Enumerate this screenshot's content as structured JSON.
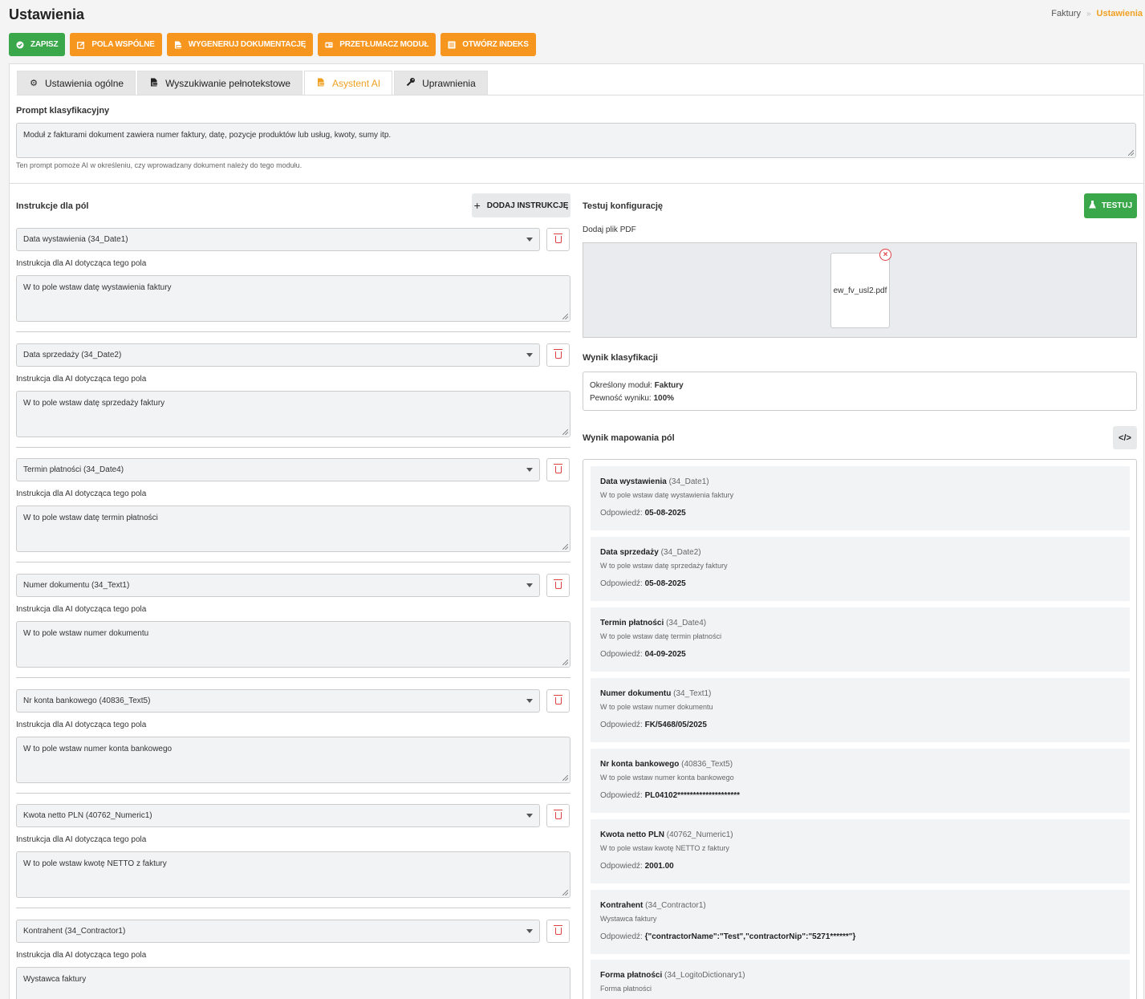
{
  "page_title": "Ustawienia",
  "breadcrumb": {
    "parent": "Faktury",
    "separator": "»",
    "current": "Ustawienia"
  },
  "toolbar": {
    "save": "ZAPISZ",
    "common_fields": "POLA WSPÓLNE",
    "generate_docs": "WYGENERUJ DOKUMENTACJĘ",
    "translate_module": "PRZETŁUMACZ MODUŁ",
    "open_index": "OTWÓRZ INDEKS"
  },
  "tabs": [
    {
      "label": "Ustawienia ogólne",
      "icon": "gear-icon"
    },
    {
      "label": "Wyszukiwanie pełnotekstowe",
      "icon": "pdf-file-icon"
    },
    {
      "label": "Asystent AI",
      "icon": "pdf-file-icon",
      "active": true
    },
    {
      "label": "Uprawnienia",
      "icon": "key-icon"
    }
  ],
  "prompt": {
    "label": "Prompt klasyfikacyjny",
    "value": "Moduł z fakturami dokument zawiera numer faktury, datę, pozycje produktów lub usług, kwoty, sumy itp.",
    "hint": "Ten prompt pomoże AI w określeniu, czy wprowadzany dokument należy do tego modułu."
  },
  "instructions": {
    "label": "Instrukcje dla pól",
    "add_button": "DODAJ INSTRUKCJĘ",
    "instr_label": "Instrukcja dla AI dotycząca tego pola",
    "fields": [
      {
        "select": "Data wystawienia (34_Date1)",
        "instruction": "W to pole wstaw datę wystawienia faktury"
      },
      {
        "select": "Data sprzedaży (34_Date2)",
        "instruction": "W to pole wstaw datę sprzedaży faktury"
      },
      {
        "select": "Termin płatności (34_Date4)",
        "instruction": "W to pole wstaw datę termin płatności"
      },
      {
        "select": "Numer dokumentu (34_Text1)",
        "instruction": "W to pole wstaw numer dokumentu"
      },
      {
        "select": "Nr konta bankowego (40836_Text5)",
        "instruction": "W to pole wstaw numer konta bankowego"
      },
      {
        "select": "Kwota netto PLN (40762_Numeric1)",
        "instruction": "W to pole wstaw kwotę NETTO z faktury"
      },
      {
        "select": "Kontrahent (34_Contractor1)",
        "instruction": "Wystawca faktury"
      }
    ]
  },
  "test": {
    "label": "Testuj konfigurację",
    "button": "TESTUJ",
    "add_pdf_label": "Dodaj plik PDF",
    "file_name": "ew_fv_usl2.pdf",
    "classification_label": "Wynik klasyfikacji",
    "module_label": "Określony moduł:",
    "module_value": "Faktury",
    "certainty_label": "Pewność wyniku:",
    "certainty_value": "100%",
    "mapping_label": "Wynik mapowania pól",
    "code_button": "</>"
  },
  "mapping": {
    "answer_label": "Odpowiedź:",
    "items": [
      {
        "name": "Data wystawienia",
        "code": "(34_Date1)",
        "desc": "W to pole wstaw datę wystawienia faktury",
        "answer": "05-08-2025"
      },
      {
        "name": "Data sprzedaży",
        "code": "(34_Date2)",
        "desc": "W to pole wstaw datę sprzedaży faktury",
        "answer": "05-08-2025"
      },
      {
        "name": "Termin płatności",
        "code": "(34_Date4)",
        "desc": "W to pole wstaw datę termin płatności",
        "answer": "04-09-2025"
      },
      {
        "name": "Numer dokumentu",
        "code": "(34_Text1)",
        "desc": "W to pole wstaw numer dokumentu",
        "answer": "FK/5468/05/2025"
      },
      {
        "name": "Nr konta bankowego",
        "code": "(40836_Text5)",
        "desc": "W to pole wstaw numer konta bankowego",
        "answer": "PL04102********************"
      },
      {
        "name": "Kwota netto PLN",
        "code": "(40762_Numeric1)",
        "desc": "W to pole wstaw kwotę NETTO z faktury",
        "answer": "2001.00"
      },
      {
        "name": "Kontrahent",
        "code": "(34_Contractor1)",
        "desc": "Wystawca faktury",
        "answer": "{\"contractorName\":\"Test\",\"contractorNip\":\"5271******\"}"
      },
      {
        "name": "Forma płatności",
        "code": "(34_LogitoDictionary1)",
        "desc": "Forma płatności",
        "answer": ""
      }
    ]
  }
}
